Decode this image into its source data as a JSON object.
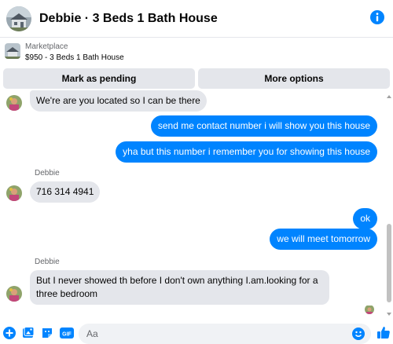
{
  "header": {
    "title": "Debbie · 3 Beds 1 Bath House",
    "info_icon": "info-icon"
  },
  "marketplace": {
    "label": "Marketplace",
    "listing": "$950 - 3 Beds 1 Bath House"
  },
  "actions": {
    "mark_pending": "Mark as pending",
    "more_options": "More options"
  },
  "messages": [
    {
      "from": "them",
      "text": "We're are you located so I can be there"
    },
    {
      "from": "me",
      "text": "send me contact number i will show you this house"
    },
    {
      "from": "me",
      "text": "yha but this number i remember you for showing this house"
    },
    {
      "from": "them",
      "sender": "Debbie",
      "text": "716 314 4941"
    },
    {
      "from": "me",
      "text": "ok"
    },
    {
      "from": "me",
      "text": "we will meet tomorrow"
    },
    {
      "from": "them",
      "sender": "Debbie",
      "text": "But I never showed th before I don't own anything I.am.looking for a three bedroom"
    }
  ],
  "composer": {
    "placeholder": "Aa",
    "icons": [
      "plus-icon",
      "photo-icon",
      "sticker-icon",
      "gif-icon",
      "emoji-icon",
      "like-icon"
    ],
    "gif_label": "GIF"
  },
  "colors": {
    "accent": "#0084ff",
    "incoming_bubble": "#e4e6eb",
    "secondary_text": "#65676b"
  }
}
